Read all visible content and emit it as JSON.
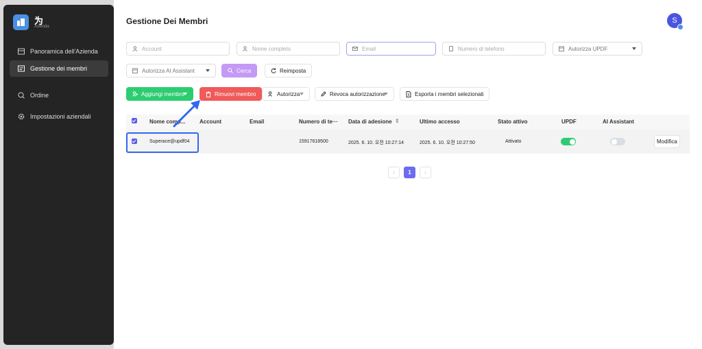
{
  "sidebar": {
    "logo_name": "为",
    "logo_sub": "Azienda",
    "items": [
      {
        "label": "Panoramica dell'Azienda"
      },
      {
        "label": "Gestione dei membri"
      },
      {
        "label": "Ordine"
      },
      {
        "label": "Impostazioni aziendali"
      }
    ]
  },
  "header": {
    "title": "Gestione Dei Membri",
    "avatar_letter": "S"
  },
  "filters": {
    "account": "Account",
    "full_name": "Nome completo",
    "email": "Email",
    "phone": "Numero di telefono",
    "authorize_updf": "Autorizza UPDF",
    "authorize_ai": "Autorizza AI Assistant",
    "search": "Cerca",
    "reset": "Reimposta"
  },
  "actions": {
    "add_member": "Aggiungi membro",
    "remove_member": "Rimuovi membro",
    "authorize": "Autorizza",
    "revoke": "Revoca autorizzazione",
    "export": "Esporta i membri selezionati"
  },
  "table": {
    "columns": [
      "Nome comp...",
      "Account",
      "Email",
      "Numero di te···",
      "Data di adesione",
      "Ultimo accesso",
      "Stato attivo",
      "UPDF",
      "AI Assistant"
    ],
    "rows": [
      {
        "name": "Superace@updf04",
        "account": "",
        "email": "",
        "phone": "15917618500",
        "joined": "2025. 6. 10. 오전 10:27:14",
        "last_access": "2025. 6. 10. 오전 10:27:50",
        "status": "Attivato",
        "updf": true,
        "ai_assistant": false,
        "edit": "Modifica"
      }
    ]
  },
  "pagination": {
    "prev": "‹",
    "current": "1",
    "next": "›"
  },
  "colors": {
    "accent": "#5b5ee8",
    "green": "#2ecc71",
    "red": "#f05a5a",
    "highlight": "#2f67f0"
  }
}
